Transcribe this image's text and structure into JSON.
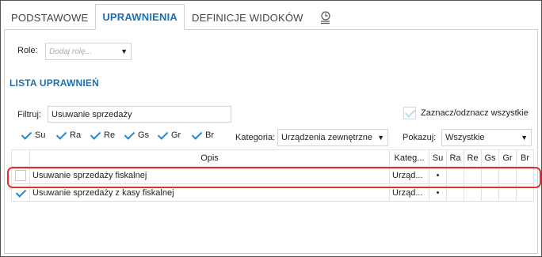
{
  "tabs": [
    {
      "label": "PODSTAWOWE"
    },
    {
      "label": "UPRAWNIENIA"
    },
    {
      "label": "DEFINICJE WIDOKÓW"
    }
  ],
  "role": {
    "label": "Role:",
    "placeholder": "Dodaj rolę..."
  },
  "section_title": "LISTA UPRAWNIEŃ",
  "filter": {
    "label": "Filtruj:",
    "value": "Usuwanie sprzedaży"
  },
  "select_all": {
    "label": "Zaznacz/odznacz wszystkie"
  },
  "flags": [
    {
      "label": "Su",
      "checked": true
    },
    {
      "label": "Ra",
      "checked": true
    },
    {
      "label": "Re",
      "checked": true
    },
    {
      "label": "Gs",
      "checked": true
    },
    {
      "label": "Gr",
      "checked": true
    },
    {
      "label": "Br",
      "checked": true
    }
  ],
  "category": {
    "label": "Kategoria:",
    "value": "Urządzenia zewnętrzne"
  },
  "show": {
    "label": "Pokazuj:",
    "value": "Wszystkie"
  },
  "grid": {
    "headers": {
      "opis": "Opis",
      "kategoria": "Kateg...",
      "flags": [
        "Su",
        "Ra",
        "Re",
        "Gs",
        "Gr",
        "Br"
      ]
    },
    "rows": [
      {
        "checked": false,
        "opis": "Usuwanie sprzedaży fiskalnej",
        "kategoria": "Urząd...",
        "su": "•"
      },
      {
        "checked": true,
        "opis": "Usuwanie sprzedaży z kasy fiskalnej",
        "kategoria": "Urząd...",
        "su": "•"
      }
    ]
  },
  "accent": "#1f6fb5",
  "highlight_color": "#e03030"
}
